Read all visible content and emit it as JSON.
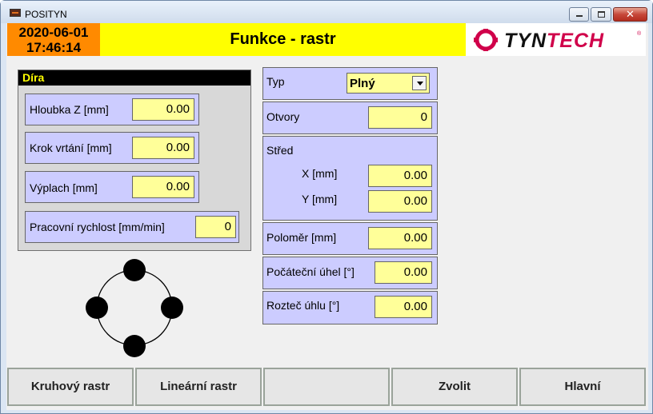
{
  "window": {
    "title": "POSITYN"
  },
  "header": {
    "date": "2020-06-01",
    "time": "17:46:14",
    "title": "Funkce - rastr",
    "logo": {
      "part1": "TYN",
      "part2": "TECH",
      "reg": "®"
    }
  },
  "dira": {
    "title": "Díra",
    "fields": [
      {
        "label": "Hloubka Z [mm]",
        "value": "0.00"
      },
      {
        "label": "Krok vrtání [mm]",
        "value": "0.00"
      },
      {
        "label": "Výplach [mm]",
        "value": "0.00"
      },
      {
        "label": "Pracovní rychlost [mm/min]",
        "value": "0"
      }
    ]
  },
  "params": {
    "typ": {
      "label": "Typ",
      "value": "Plný"
    },
    "otvory": {
      "label": "Otvory",
      "value": "0"
    },
    "stred": {
      "label": "Střed",
      "x_label": "X [mm]",
      "x_value": "0.00",
      "y_label": "Y [mm]",
      "y_value": "0.00"
    },
    "polomer": {
      "label": "Poloměr [mm]",
      "value": "0.00"
    },
    "pocatecni_uhel": {
      "label": "Počáteční úhel [°]",
      "value": "0.00"
    },
    "roztec_uhlu": {
      "label": "Rozteč úhlu [°]",
      "value": "0.00"
    }
  },
  "buttons": {
    "kruhovy": "Kruhový rastr",
    "linearni": "Lineární rastr",
    "empty": "",
    "zvolit": "Zvolit",
    "hlavni": "Hlavní"
  },
  "colors": {
    "header_yellow": "#ffff00",
    "datetime_orange": "#ff8a00",
    "panel_lavender": "#ccccff",
    "value_yellow": "#ffff99",
    "brand_magenta": "#d0004a"
  }
}
